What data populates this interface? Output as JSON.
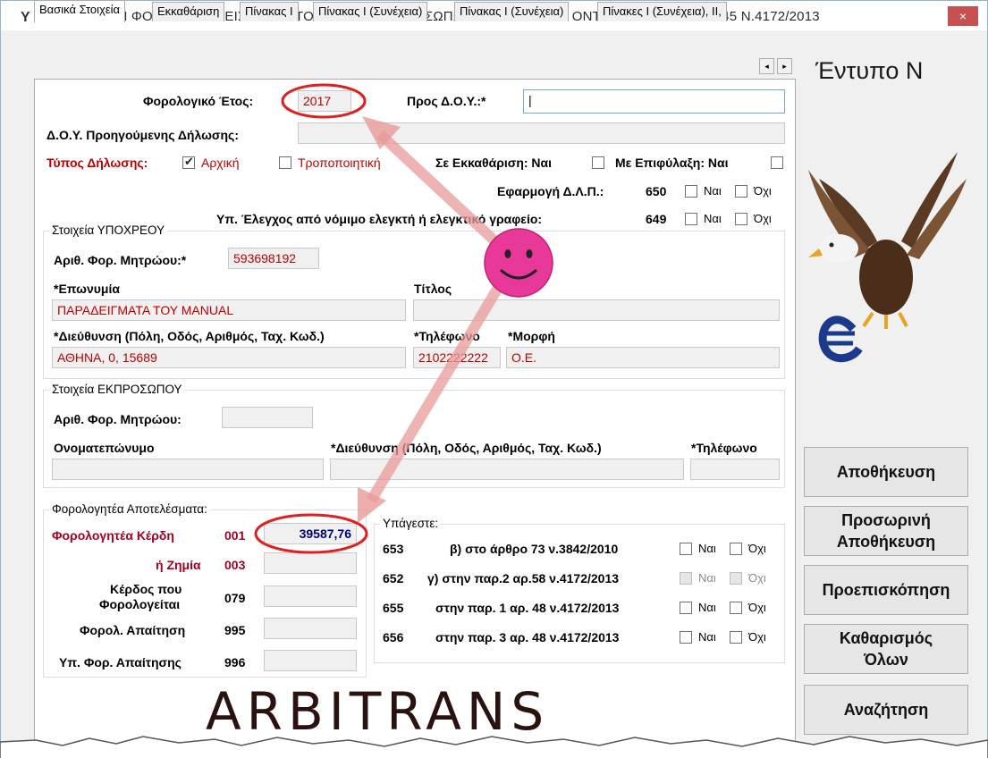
{
  "window": {
    "title": "Ν - ΔΗΛΩΣΗ ΦΟΡΟΛΟΓΙΑΣ ΕΙΣΟΔΗΜΑΤΟΣ ΝΟΜΙΚΩΝ ΠΡΟΣΩΠΩΝ ΚΑΙ ΝΟΜΙΚΩΝ ΟΝΤΟΤΗΤΩΝ ΑΡΘΡΟΥ 45 Ν.4172/2013",
    "close": "×",
    "app_icon": "Y"
  },
  "tabs": [
    "Βασικά Στοιχεία",
    "Εκκαθάριση",
    "Πίνακας Ι",
    "Πίνακας Ι (Συνέχεια)",
    "Πίνακας Ι (Συνέχεια)",
    "Πίνακες Ι (Συνέχεια), ΙΙ,"
  ],
  "tab_scroll": {
    "left": "◂",
    "right": "▸"
  },
  "header": {
    "year_label": "Φορολογικό Έτος:",
    "year_value": "2017",
    "doy_label": "Προς Δ.Ο.Υ.:*",
    "doy_value": "|",
    "prev_doy_label": "Δ.Ο.Υ. Προηγούμενης Δήλωσης:",
    "decl_type_label": "Τύπος Δήλωσης:",
    "initial_label": "Αρχική",
    "amending_label": "Τροποποιητική",
    "liquidation_label": "Σε Εκκαθάριση: Ναι",
    "reservation_label": "Με Επιφύλαξη: Ναι",
    "dlp_label": "Εφαρμογή Δ.Λ.Π.:",
    "dlp_code": "650",
    "audit_label": "Υπ. Έλεγχος από νόμιμο ελεγκτή ή ελεγκτικό γραφείο:",
    "audit_code": "649",
    "yes": "Ναι",
    "no": "Όχι"
  },
  "obligor": {
    "group_title": "Στοιχεία ΥΠΟΧΡΕΟΥ",
    "afm_label": "Αριθ. Φορ. Μητρώου:*",
    "afm_value": "593698192",
    "name_label": "*Επωνυμία",
    "name_value": "ΠΑΡΑΔΕΙΓΜΑΤΑ ΤΟΥ MANUAL",
    "title_label": "Τίτλος",
    "address_label": "*Διεύθυνση (Πόλη, Οδός, Αριθμός, Ταχ. Κωδ.)",
    "address_value": "ΑΘΗΝΑ, 0, 15689",
    "phone_label": "*Τηλέφωνο",
    "phone_value": "2102222222",
    "form_label": "*Μορφή",
    "form_value": "Ο.Ε."
  },
  "representative": {
    "group_title": "Στοιχεία ΕΚΠΡΟΣΩΠΟΥ",
    "afm_label": "Αριθ. Φορ. Μητρώου:",
    "fullname_label": "Ονοματεπώνυμο",
    "address_label": "*Διεύθυνση (Πόλη, Οδός, Αριθμός, Ταχ. Κωδ.)",
    "phone_label": "*Τηλέφωνο"
  },
  "results": {
    "group_title": "Φορολογητέα Αποτελέσματα:",
    "profit_label": "Φορολογητέα Κέρδη",
    "profit_code": "001",
    "profit_value": "39587,76",
    "loss_label": "ή Ζημία",
    "loss_code": "003",
    "taxed_profit_label_1": "Κέρδος που",
    "taxed_profit_label_2": "Φορολογείται",
    "taxed_profit_code": "079",
    "claim_label": "Φορολ. Απαίτηση",
    "claim_code": "995",
    "sub_claim_label": "Υπ. Φορ. Απαίτησης",
    "sub_claim_code": "996"
  },
  "subject": {
    "group_title": "Υπάγεστε:",
    "rows": [
      {
        "code": "653",
        "text": "β) στο άρθρο 73 ν.3842/2010"
      },
      {
        "code": "652",
        "text": "γ) στην παρ.2 αρ.58 ν.4172/2013"
      },
      {
        "code": "655",
        "text": "στην παρ. 1 αρ. 48 ν.4172/2013"
      },
      {
        "code": "656",
        "text": "στην παρ. 3 αρ. 48 ν.4172/2013"
      }
    ]
  },
  "side": {
    "form_title": "Έντυπο Ν",
    "save": "Αποθήκευση",
    "temp_save_1": "Προσωρινή",
    "temp_save_2": "Αποθήκευση",
    "preview": "Προεπισκόπηση",
    "clear_1": "Καθαρισμός",
    "clear_2": "Όλων",
    "search": "Αναζήτηση"
  },
  "brand": "ARBITRANS",
  "colors": {
    "accent_red": "#c00000",
    "annotation_red": "#e02020",
    "value_blue": "#000080",
    "smiley": "#e8389a"
  }
}
